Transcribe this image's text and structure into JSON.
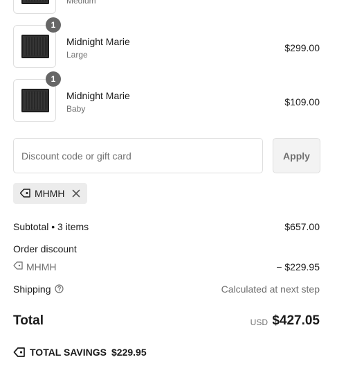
{
  "line_items": [
    {
      "name": "",
      "variant": "Medium",
      "price": "",
      "quantity": ""
    },
    {
      "name": "Midnight Marie",
      "variant": "Large",
      "price": "$299.00",
      "quantity": "1"
    },
    {
      "name": "Midnight Marie",
      "variant": "Baby",
      "price": "$109.00",
      "quantity": "1"
    }
  ],
  "discount": {
    "placeholder": "Discount code or gift card",
    "apply_label": "Apply",
    "applied_code": "MHMH"
  },
  "summary": {
    "subtotal_label": "Subtotal • 3 items",
    "subtotal_value": "$657.00",
    "order_discount_label": "Order discount",
    "discount_code": "MHMH",
    "discount_value": "− $229.95",
    "shipping_label": "Shipping",
    "shipping_value": "Calculated at next step",
    "total_label": "Total",
    "currency": "USD",
    "total_value": "$427.05",
    "savings_label": "TOTAL SAVINGS",
    "savings_value": "$229.95"
  },
  "icons": {
    "tag": "tag-icon",
    "remove": "close-icon",
    "help": "help-circle-icon"
  }
}
